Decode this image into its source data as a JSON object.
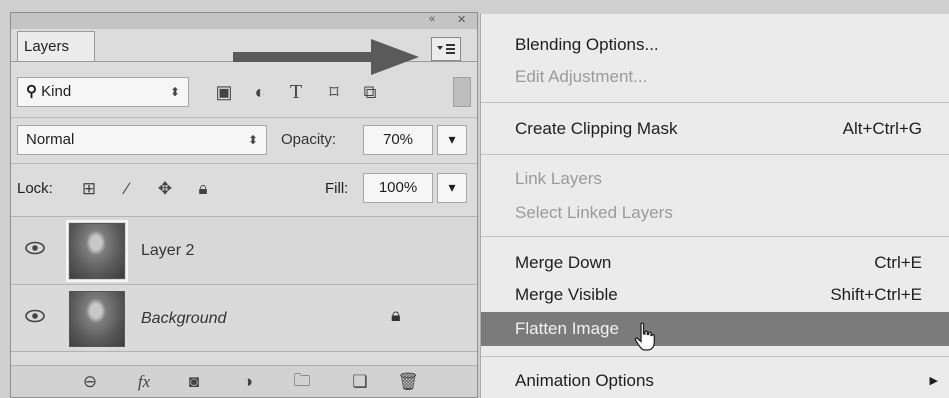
{
  "layers_panel": {
    "tab_label": "Layers",
    "filter": {
      "selected": "Kind"
    },
    "blend_mode": "Normal",
    "opacity": {
      "label": "Opacity:",
      "value": "70%"
    },
    "lock": {
      "label": "Lock:"
    },
    "fill": {
      "label": "Fill:",
      "value": "100%"
    },
    "layers": [
      {
        "name": "Layer 2",
        "visible": true,
        "selected": true
      },
      {
        "name": "Background",
        "visible": true,
        "locked": true
      }
    ]
  },
  "context_menu": {
    "items": [
      {
        "label": "Blending Options...",
        "enabled": true
      },
      {
        "label": "Edit Adjustment...",
        "enabled": false
      },
      {
        "label": "Create Clipping Mask",
        "shortcut": "Alt+Ctrl+G",
        "enabled": true
      },
      {
        "label": "Link Layers",
        "enabled": false
      },
      {
        "label": "Select Linked Layers",
        "enabled": false
      },
      {
        "label": "Merge Down",
        "shortcut": "Ctrl+E",
        "enabled": true
      },
      {
        "label": "Merge Visible",
        "shortcut": "Shift+Ctrl+E",
        "enabled": true
      },
      {
        "label": "Flatten Image",
        "enabled": true,
        "highlighted": true
      },
      {
        "label": "Animation Options",
        "enabled": true,
        "has_submenu": true
      }
    ]
  },
  "colors": {
    "highlight": "#7b7b7b",
    "arrow": "#5a5a5a",
    "disabled_text": "#9a9a9a"
  }
}
